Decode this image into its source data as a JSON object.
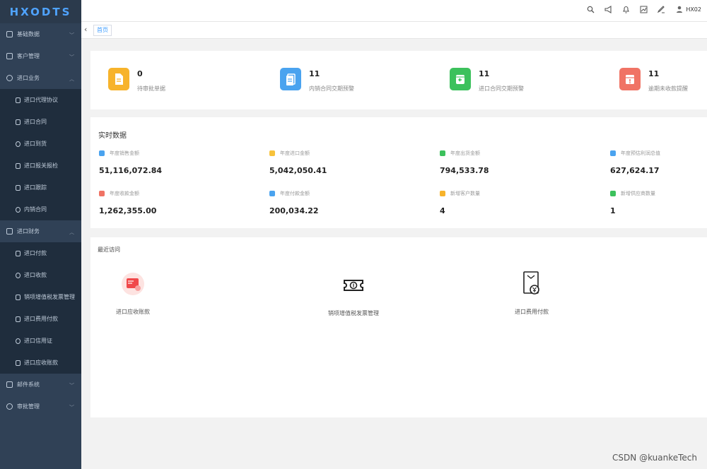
{
  "app": {
    "logo": "HXODTS"
  },
  "sidebar": {
    "items": [
      {
        "label": "基础数据",
        "chevron": "﹀"
      },
      {
        "label": "客户管理",
        "chevron": "﹀"
      },
      {
        "label": "进口业务",
        "chevron": "︿"
      },
      {
        "label": "进口代理协议"
      },
      {
        "label": "进口合同"
      },
      {
        "label": "进口到货"
      },
      {
        "label": "进口报关报检"
      },
      {
        "label": "进口跟踪"
      },
      {
        "label": "内销合同"
      },
      {
        "label": "进口财务",
        "chevron": "︿"
      },
      {
        "label": "进口付款"
      },
      {
        "label": "进口收款"
      },
      {
        "label": "销项增值税发票管理"
      },
      {
        "label": "进口费用付款"
      },
      {
        "label": "进口信用证"
      },
      {
        "label": "进口应收账款"
      },
      {
        "label": "邮件系统",
        "chevron": "﹀"
      },
      {
        "label": "审批管理",
        "chevron": "﹀"
      }
    ]
  },
  "header": {
    "user": "HX02",
    "icons": [
      "search-icon",
      "megaphone-icon",
      "bell-icon",
      "chart-icon",
      "edit-icon",
      "user-icon"
    ]
  },
  "tabs": {
    "back": "‹",
    "home": "首页"
  },
  "stats": [
    {
      "value": "0",
      "label": "待审批单据",
      "color": "#f7b32b",
      "icon": "document-icon"
    },
    {
      "value": "11",
      "label": "内销合同交期预警",
      "color": "#4aa3ef",
      "icon": "contract-icon"
    },
    {
      "value": "11",
      "label": "进口合同交期预警",
      "color": "#3cc15c",
      "icon": "box-return-icon"
    },
    {
      "value": "11",
      "label": "逾期未收款提醒",
      "color": "#f07365",
      "icon": "calendar-alert-icon"
    }
  ],
  "realtime": {
    "title": "实时数据",
    "metrics": [
      {
        "label": "年度销售金额",
        "value": "51,116,072.84",
        "color": "#4aa3ef"
      },
      {
        "label": "年度进口金额",
        "value": "5,042,050.41",
        "color": "#f7c23b"
      },
      {
        "label": "年度出货金额",
        "value": "794,533.78",
        "color": "#3cc15c"
      },
      {
        "label": "年度预估利润总值",
        "value": "627,624.17",
        "color": "#4aa3ef"
      },
      {
        "label": "年度收款金额",
        "value": "1,262,355.00",
        "color": "#f07365"
      },
      {
        "label": "年度付款金额",
        "value": "200,034.22",
        "color": "#4aa3ef"
      },
      {
        "label": "新增客户数量",
        "value": "4",
        "color": "#f7b32b"
      },
      {
        "label": "新增供应商数量",
        "value": "1",
        "color": "#3cc15c"
      }
    ]
  },
  "recent": {
    "title": "最近访问",
    "items": [
      {
        "label": "进口应收账款",
        "icon": "receivable-card-icon"
      },
      {
        "label": "销项增值税发票管理",
        "icon": "ticket-icon"
      },
      {
        "label": "进口费用付款",
        "icon": "yen-bill-icon"
      }
    ]
  },
  "watermark": "CSDN @kuankeTech"
}
